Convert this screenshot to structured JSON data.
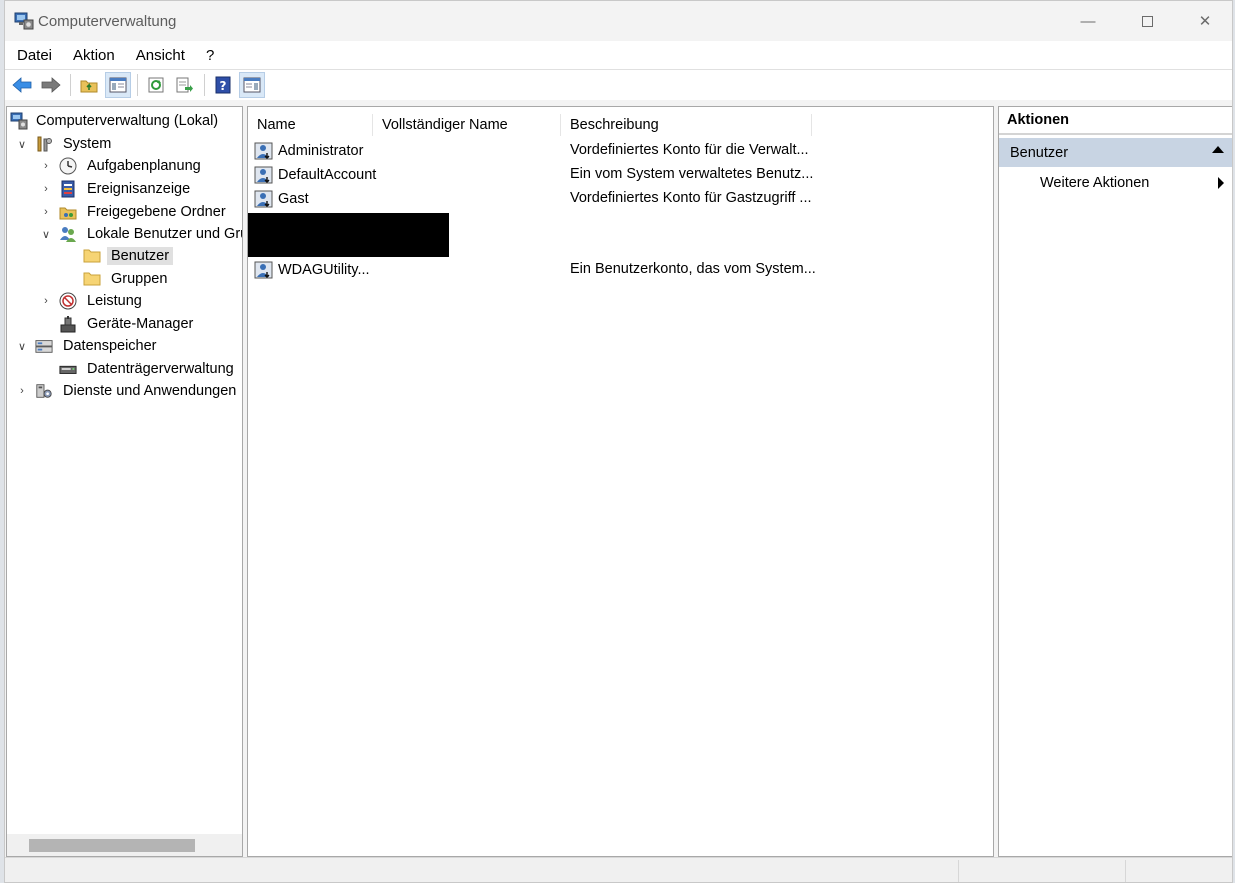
{
  "window": {
    "title": "Computerverwaltung",
    "minimize_glyph": "—",
    "close_glyph": "✕"
  },
  "menu": [
    "Datei",
    "Aktion",
    "Ansicht",
    "?"
  ],
  "toolbar": {
    "icons": [
      "back-arrow-icon",
      "forward-arrow-icon",
      "up-folder-icon",
      "show-hide-tree-icon",
      "refresh-icon",
      "export-list-icon",
      "help-icon",
      "show-hide-action-pane-icon"
    ]
  },
  "tree": {
    "root": "Computerverwaltung (Lokal)",
    "system": "System",
    "aufgabenplanung": "Aufgabenplanung",
    "ereignisanzeige": "Ereignisanzeige",
    "freigegebene_ordner": "Freigegebene Ordner",
    "lokale_benutzer": "Lokale Benutzer und Gru",
    "benutzer": "Benutzer",
    "gruppen": "Gruppen",
    "leistung": "Leistung",
    "geraete_manager": "Geräte-Manager",
    "datenspeicher": "Datenspeicher",
    "datentraegerverwaltung": "Datenträgerverwaltung",
    "dienste": "Dienste und Anwendungen",
    "selected": "Benutzer"
  },
  "list": {
    "columns": [
      "Name",
      "Vollständiger Name",
      "Beschreibung"
    ],
    "rows": [
      {
        "name": "Administrator",
        "full_name": "",
        "description": "Vordefiniertes Konto für die Verwalt..."
      },
      {
        "name": "DefaultAccount",
        "full_name": "",
        "description": "Ein vom System verwaltetes Benutz..."
      },
      {
        "name": "Gast",
        "full_name": "",
        "description": "Vordefiniertes Konto für Gastzugriff ..."
      },
      {
        "name": "WDAGUtility...",
        "full_name": "",
        "description": "Ein Benutzerkonto, das vom System..."
      }
    ]
  },
  "actions": {
    "header": "Aktionen",
    "section": "Benutzer",
    "item": "Weitere Aktionen"
  },
  "colors": {
    "selection_header": "#c8d4e3",
    "toolbar_pressed": "#d9e8f7"
  }
}
